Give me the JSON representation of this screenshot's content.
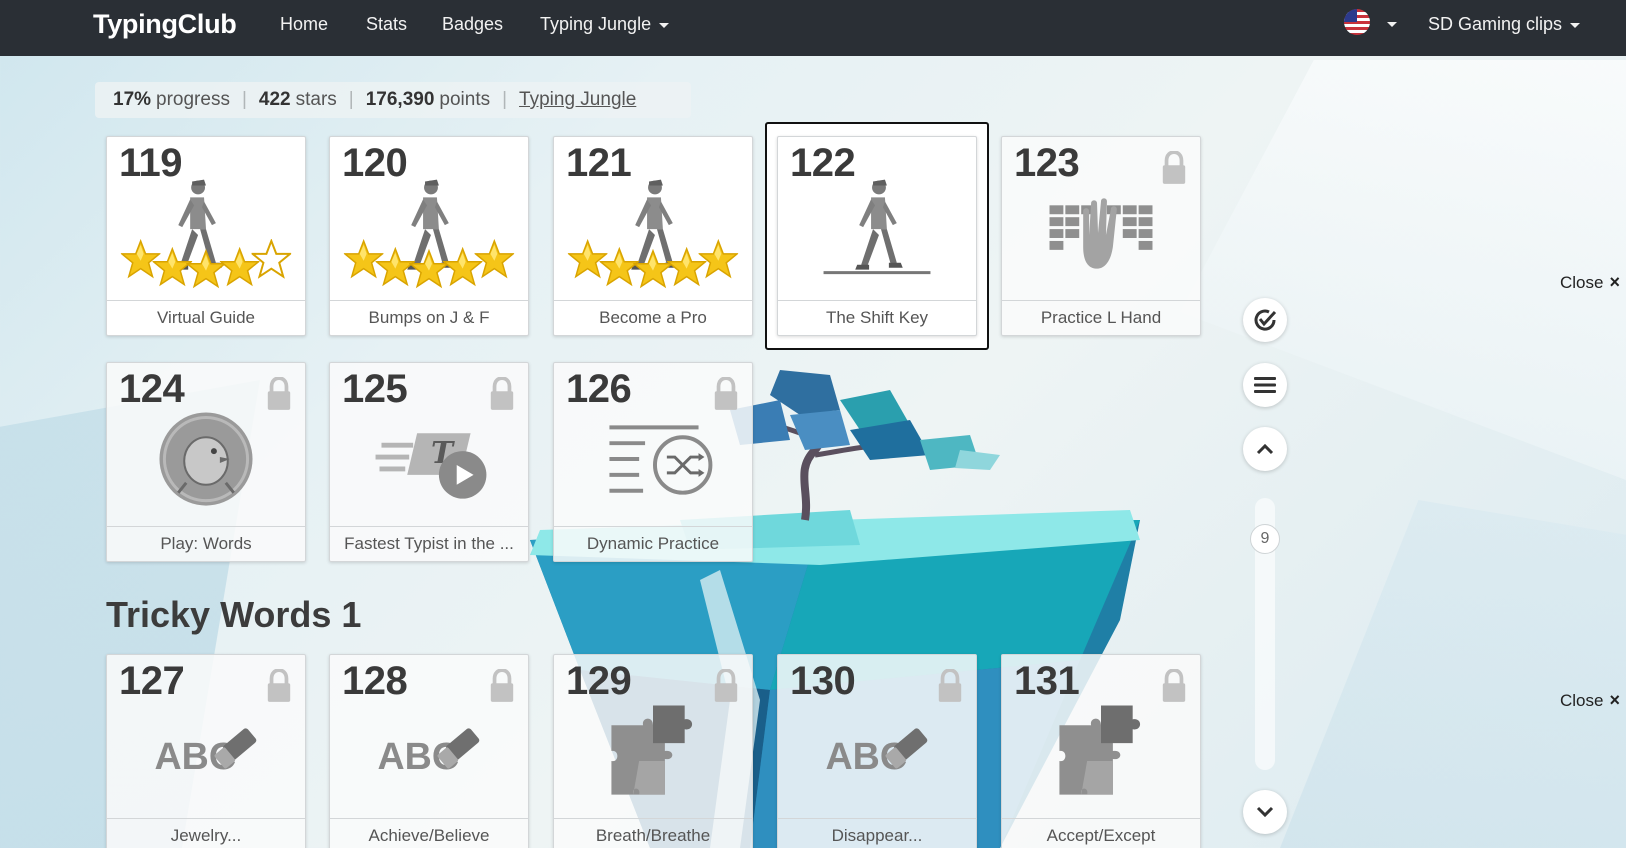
{
  "navbar": {
    "brand": "TypingClub",
    "links": [
      "Home",
      "Stats",
      "Badges",
      "Typing Jungle"
    ],
    "user": "SD Gaming clips"
  },
  "progress": {
    "percent": "17%",
    "percent_label": "progress",
    "stars": "422",
    "stars_label": "stars",
    "points": "176,390",
    "points_label": "points",
    "link": "Typing Jungle"
  },
  "lessons_row1": [
    {
      "num": "119",
      "label": "Virtual Guide",
      "stars": 4
    },
    {
      "num": "120",
      "label": "Bumps on J & F",
      "stars": 5
    },
    {
      "num": "121",
      "label": "Become a Pro",
      "stars": 5
    },
    {
      "num": "122",
      "label": "The Shift Key",
      "stars": 0
    },
    {
      "num": "123",
      "label": "Practice L Hand",
      "stars": 0
    }
  ],
  "lessons_row2": [
    {
      "num": "124",
      "label": "Play: Words"
    },
    {
      "num": "125",
      "label": "Fastest Typist in the ..."
    },
    {
      "num": "126",
      "label": "Dynamic Practice"
    }
  ],
  "section_title": "Tricky Words 1",
  "lessons_row3": [
    {
      "num": "127",
      "label": "Jewelry..."
    },
    {
      "num": "128",
      "label": "Achieve/Believe"
    },
    {
      "num": "129",
      "label": "Breath/Breathe"
    },
    {
      "num": "130",
      "label": "Disappear..."
    },
    {
      "num": "131",
      "label": "Accept/Except"
    }
  ],
  "abc_text": "ABC",
  "typing_letter": "T",
  "scroll_level": "9",
  "close_label": "Close",
  "colors": {
    "navbar": "#2a2f35",
    "star": "#f5c518",
    "icon_gray": "#8a8a8a"
  }
}
